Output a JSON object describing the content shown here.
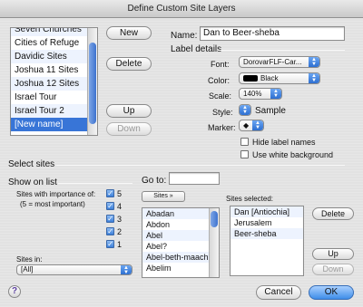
{
  "window": {
    "title": "Define Custom Site Layers"
  },
  "layers": {
    "items": [
      {
        "label": "Seven Churches"
      },
      {
        "label": "Cities of Refuge"
      },
      {
        "label": "Davidic Sites"
      },
      {
        "label": "Joshua 11 Sites"
      },
      {
        "label": "Joshua 12 Sites"
      },
      {
        "label": "Israel Tour"
      },
      {
        "label": "Israel Tour 2"
      },
      {
        "label": "[New name]"
      }
    ],
    "selected_index": 7,
    "buttons": {
      "new": "New",
      "delete": "Delete",
      "up": "Up",
      "down": "Down"
    }
  },
  "name": {
    "label": "Name:",
    "value": "Dan to Beer-sheba"
  },
  "label_details": {
    "heading": "Label details",
    "font_label": "Font:",
    "font_value": "DorovarFLF-Car...",
    "color_label": "Color:",
    "color_value": "Black",
    "color_hex": "#000000",
    "scale_label": "Scale:",
    "scale_value": "140%",
    "style_label": "Style:",
    "style_value": "Sample",
    "marker_label": "Marker:",
    "marker_value": "◆",
    "hide_label_names": "Hide label names",
    "use_white_background": "Use white background"
  },
  "select_sites": {
    "heading": "Select sites",
    "show_on_list": "Show on list",
    "importance_label_1": "Sites with importance of:",
    "importance_label_2": "(5 = most important)",
    "importance": [
      {
        "value": "5",
        "checked": true
      },
      {
        "value": "4",
        "checked": true
      },
      {
        "value": "3",
        "checked": true
      },
      {
        "value": "2",
        "checked": true
      },
      {
        "value": "1",
        "checked": true
      }
    ],
    "sites_in_label": "Sites in:",
    "sites_in_value": "[All]",
    "goto_label": "Go to:",
    "goto_value": "",
    "sites_button": "Sites »",
    "sites": [
      "Abadan",
      "Abdon",
      "Abel",
      "Abel?",
      "Abel-beth-maach...",
      "Abelim"
    ],
    "selected_heading": "Sites selected:",
    "selected_sites": [
      "Dan [Antiochia]",
      "Jerusalem",
      "Beer-sheba"
    ],
    "delete": "Delete",
    "up": "Up",
    "down": "Down"
  },
  "footer": {
    "help": "?",
    "cancel": "Cancel",
    "ok": "OK"
  },
  "colors": {
    "accent": "#3875d7",
    "selection": "#3875d7"
  }
}
